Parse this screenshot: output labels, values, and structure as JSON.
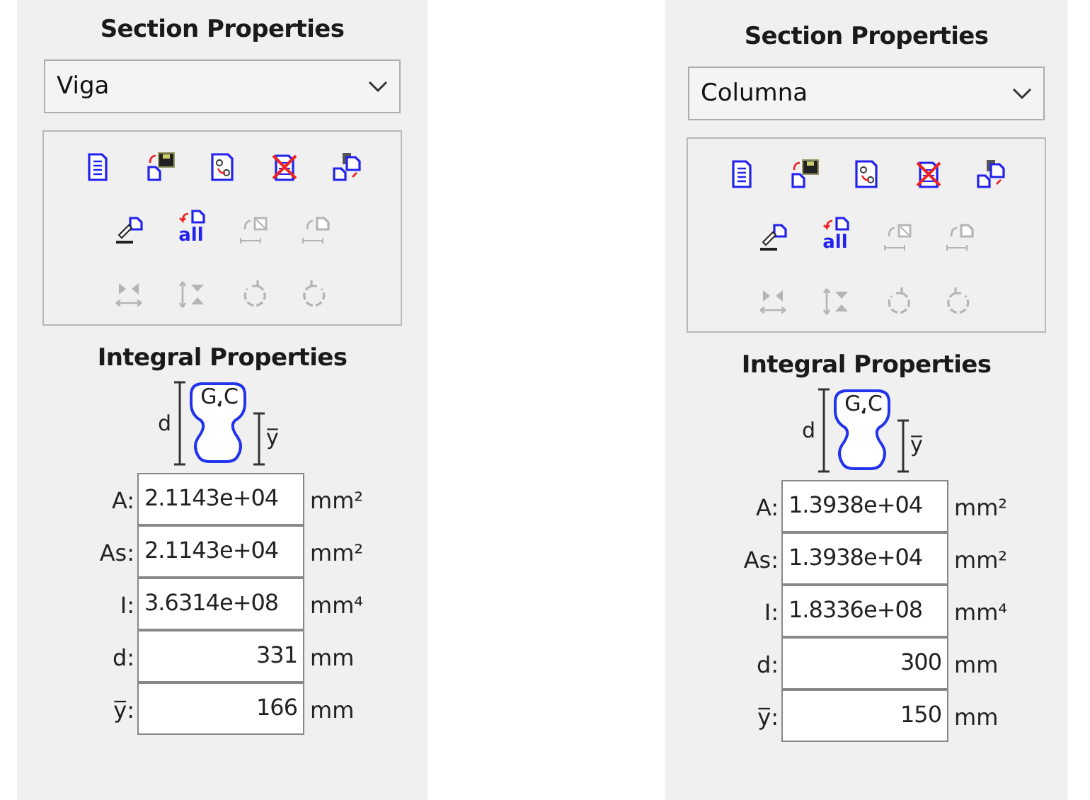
{
  "panels": [
    {
      "title": "Section Properties",
      "dropdown": {
        "value": "Viga"
      },
      "toolbar": [
        [
          {
            "disabled": false
          },
          {
            "disabled": false
          },
          {
            "disabled": false
          },
          {
            "disabled": false
          },
          {
            "disabled": false
          }
        ],
        [
          {
            "disabled": false
          },
          {
            "disabled": false,
            "label": "all"
          },
          {
            "disabled": true
          },
          {
            "disabled": true
          }
        ],
        [
          {
            "disabled": true
          },
          {
            "disabled": true
          },
          {
            "disabled": true
          },
          {
            "disabled": true
          }
        ]
      ],
      "integral": {
        "title": "Integral Properties",
        "diagram": {
          "centroid_label": "G,C",
          "depth_label": "d",
          "centroid_height_label": "y̅"
        },
        "rows": [
          {
            "label": "A:",
            "value": "2.1143e+04",
            "unit": "mm²",
            "kind": "scientific"
          },
          {
            "label": "As:",
            "value": "2.1143e+04",
            "unit": "mm²",
            "kind": "scientific"
          },
          {
            "label": "I:",
            "value": "3.6314e+08",
            "unit": "mm⁴",
            "kind": "scientific"
          },
          {
            "label": "d:",
            "value": "331",
            "unit": "mm",
            "kind": "integer"
          },
          {
            "label": "y̅:",
            "value": "166",
            "unit": "mm",
            "kind": "integer"
          }
        ]
      }
    },
    {
      "title": "Section Properties",
      "dropdown": {
        "value": "Columna"
      },
      "toolbar": [
        [
          {
            "disabled": false
          },
          {
            "disabled": false
          },
          {
            "disabled": false
          },
          {
            "disabled": false
          },
          {
            "disabled": false
          }
        ],
        [
          {
            "disabled": false
          },
          {
            "disabled": false,
            "label": "all"
          },
          {
            "disabled": true
          },
          {
            "disabled": true
          }
        ],
        [
          {
            "disabled": true
          },
          {
            "disabled": true
          },
          {
            "disabled": true
          },
          {
            "disabled": true
          }
        ]
      ],
      "integral": {
        "title": "Integral Properties",
        "diagram": {
          "centroid_label": "G,C",
          "depth_label": "d",
          "centroid_height_label": "y̅"
        },
        "rows": [
          {
            "label": "A:",
            "value": "1.3938e+04",
            "unit": "mm²",
            "kind": "scientific"
          },
          {
            "label": "As:",
            "value": "1.3938e+04",
            "unit": "mm²",
            "kind": "scientific"
          },
          {
            "label": "I:",
            "value": "1.8336e+08",
            "unit": "mm⁴",
            "kind": "scientific"
          },
          {
            "label": "d:",
            "value": "300",
            "unit": "mm",
            "kind": "integer"
          },
          {
            "label": "y̅:",
            "value": "150",
            "unit": "mm",
            "kind": "integer"
          }
        ]
      }
    }
  ]
}
